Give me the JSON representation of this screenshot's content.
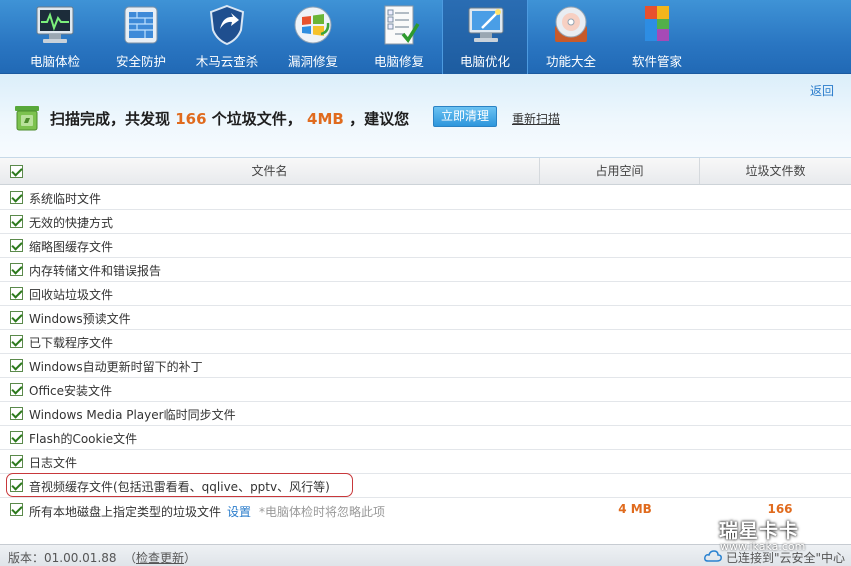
{
  "toolbar": {
    "items": [
      {
        "label": "电脑体检",
        "icon": "monitor-health-icon"
      },
      {
        "label": "安全防护",
        "icon": "firewall-icon"
      },
      {
        "label": "木马云查杀",
        "icon": "trojan-shield-icon"
      },
      {
        "label": "漏洞修复",
        "icon": "windows-patch-icon"
      },
      {
        "label": "电脑修复",
        "icon": "checklist-icon"
      },
      {
        "label": "电脑优化",
        "icon": "optimize-wand-icon"
      },
      {
        "label": "功能大全",
        "icon": "disc-toolbox-icon"
      },
      {
        "label": "软件管家",
        "icon": "software-blocks-icon"
      }
    ],
    "active_index": 5,
    "colors": {
      "bg": "#2a76c2",
      "text": "#ffffff"
    }
  },
  "summary": {
    "back_label": "返回",
    "text_prefix": "扫描完成，共发现",
    "file_count": "166",
    "text_mid": "个垃圾文件，",
    "size": "4MB",
    "text_suffix": "，建议您",
    "clean_button": "立即清理",
    "rescan_link": "重新扫描",
    "accent_color": "#e06b1e"
  },
  "table": {
    "headers": {
      "file_name": "文件名",
      "space": "占用空间",
      "count": "垃圾文件数"
    },
    "rows": [
      "系统临时文件",
      "无效的快捷方式",
      "缩略图缓存文件",
      "内存转储文件和错误报告",
      "回收站垃圾文件",
      "Windows预读文件",
      "已下载程序文件",
      "Windows自动更新时留下的补丁",
      "Office安装文件",
      "Windows Media Player临时同步文件",
      "Flash的Cookie文件",
      "日志文件",
      "音视频缓存文件(包括迅雷看看、qqlive、pptv、风行等)"
    ],
    "all_row": {
      "label": "所有本地磁盘上指定类型的垃圾文件",
      "settings": "设置",
      "hint": "*电脑体检时将忽略此项",
      "size": "4 MB",
      "count": "166"
    }
  },
  "status": {
    "version": "版本：01.00.01.88",
    "check_update_open": "（",
    "check_update": "检查更新",
    "check_update_close": "）",
    "cloud": "已连接到\"云安全\"中心"
  },
  "watermark": {
    "line1": "瑞星卡卡",
    "line2": "www.ikaka.com"
  }
}
